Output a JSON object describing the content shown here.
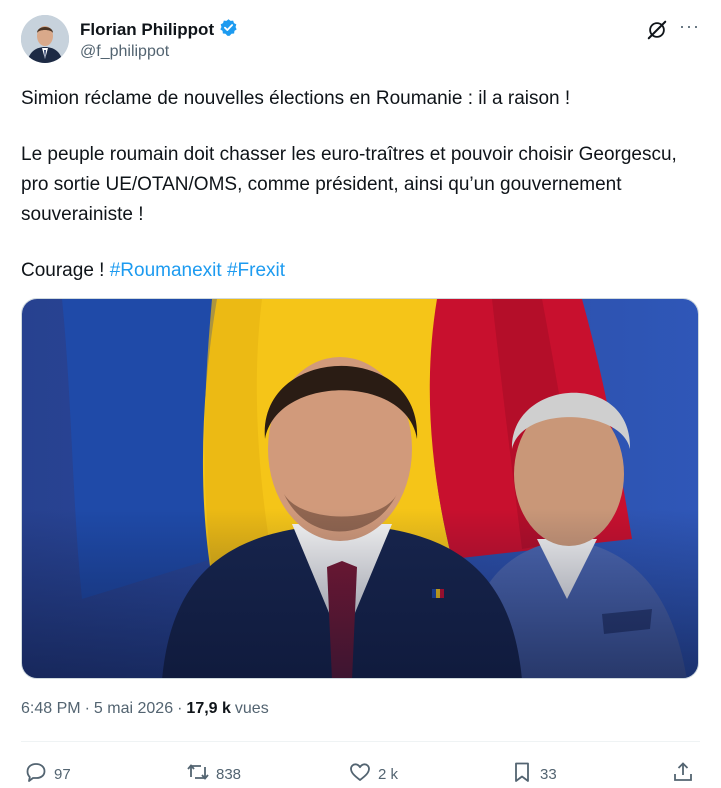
{
  "author": {
    "display_name": "Florian Philippot",
    "handle": "@f_philippot",
    "verified_color": "#1d9bf0"
  },
  "header_icons": [
    "grok-icon",
    "more-icon"
  ],
  "more_label": "···",
  "tweet": {
    "line1": "Simion réclame de nouvelles élections en Roumanie : il a raison !",
    "paragraph2": "Le peuple roumain doit chasser les euro-traîtres et pouvoir choisir Georgescu, pro sortie UE/OTAN/OMS, comme président, ainsi qu’un gouvernement souverainiste !",
    "courage": "Courage ! ",
    "hashtag1": "#Roumanexit",
    "hashtag2": "#Frexit"
  },
  "meta": {
    "time": "6:48 PM",
    "separator": "·",
    "date": "5 mai 2026",
    "views_count": "17,9 k",
    "views_label": "vues"
  },
  "actions": {
    "replies": "97",
    "reposts": "838",
    "likes": "2 k",
    "bookmarks": "33"
  },
  "colors": {
    "accent": "#1d9bf0",
    "secondary_text": "#536471",
    "flag_blue": "#1f4aa8",
    "flag_yellow": "#f5c518",
    "flag_red": "#c8102e"
  }
}
